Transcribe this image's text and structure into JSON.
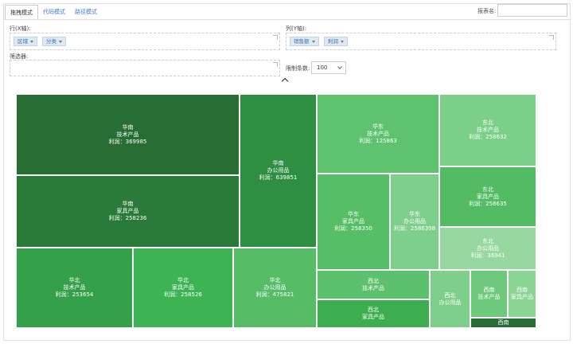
{
  "tabs": [
    {
      "label": "拖拽模式",
      "active": true
    },
    {
      "label": "代码模式",
      "active": false
    },
    {
      "label": "路径模式",
      "active": false
    }
  ],
  "report_name_label": "报表名:",
  "report_name_value": "",
  "rows_label": "行(X轴):",
  "row_chips": [
    "区域",
    "分类"
  ],
  "cols_label": "列(Y轴):",
  "col_chips": [
    "销售额",
    "利润"
  ],
  "filter_label": "筛选器:",
  "limit_label": "限制条数:",
  "limit_value": "100",
  "colors": {
    "dark": "#276d34",
    "mid": "#2e8f42",
    "green": "#3daa52",
    "light": "#5fc26e",
    "lighter": "#7fcf8c",
    "lightest": "#96d8a0"
  },
  "treemap": [
    {
      "lines": [
        "华南",
        "技术产品",
        "利润：369985"
      ],
      "color": "#276d34"
    },
    {
      "lines": [
        "华南",
        "家具产品",
        "利润：258236"
      ],
      "color": "#2a7a3a"
    },
    {
      "lines": [
        "华南",
        "办公用品",
        "利润：639851"
      ],
      "color": "#2e8f42"
    },
    {
      "lines": [
        "华北",
        "技术产品",
        "利润：253654"
      ],
      "color": "#35a04a"
    },
    {
      "lines": [
        "华北",
        "家具产品",
        "利润：258526"
      ],
      "color": "#3db354"
    },
    {
      "lines": [
        "华北",
        "办公用品",
        "利润：475821"
      ],
      "color": "#56bd66"
    },
    {
      "lines": [
        "华东",
        "技术产品",
        "利润：125863"
      ],
      "color": "#5fc26e"
    },
    {
      "lines": [
        "华东",
        "家具产品",
        "利润：258350"
      ],
      "color": "#56be66"
    },
    {
      "lines": [
        "华东",
        "办公用品",
        "利润：2586398"
      ],
      "color": "#7fcf8c"
    },
    {
      "lines": [
        "东北",
        "技术产品",
        "利润：258632"
      ],
      "color": "#7ccf89"
    },
    {
      "lines": [
        "东北",
        "家具产品",
        "利润：258635"
      ],
      "color": "#52bb63"
    },
    {
      "lines": [
        "东北",
        "办公用品",
        "利润：36941"
      ],
      "color": "#96d8a0"
    },
    {
      "lines": [
        "西北",
        "技术产品"
      ],
      "color": "#5dc06c"
    },
    {
      "lines": [
        "西北",
        "家具产品"
      ],
      "color": "#3cae50"
    },
    {
      "lines": [
        "西北",
        "办公用品"
      ],
      "color": "#7fcf8c"
    },
    {
      "lines": [
        "西南",
        "技术产品"
      ],
      "color": "#6fc97c"
    },
    {
      "lines": [
        "西南",
        "家具产品"
      ],
      "color": "#8bd595"
    },
    {
      "lines": [
        "西南"
      ],
      "color": "#276d34"
    }
  ]
}
